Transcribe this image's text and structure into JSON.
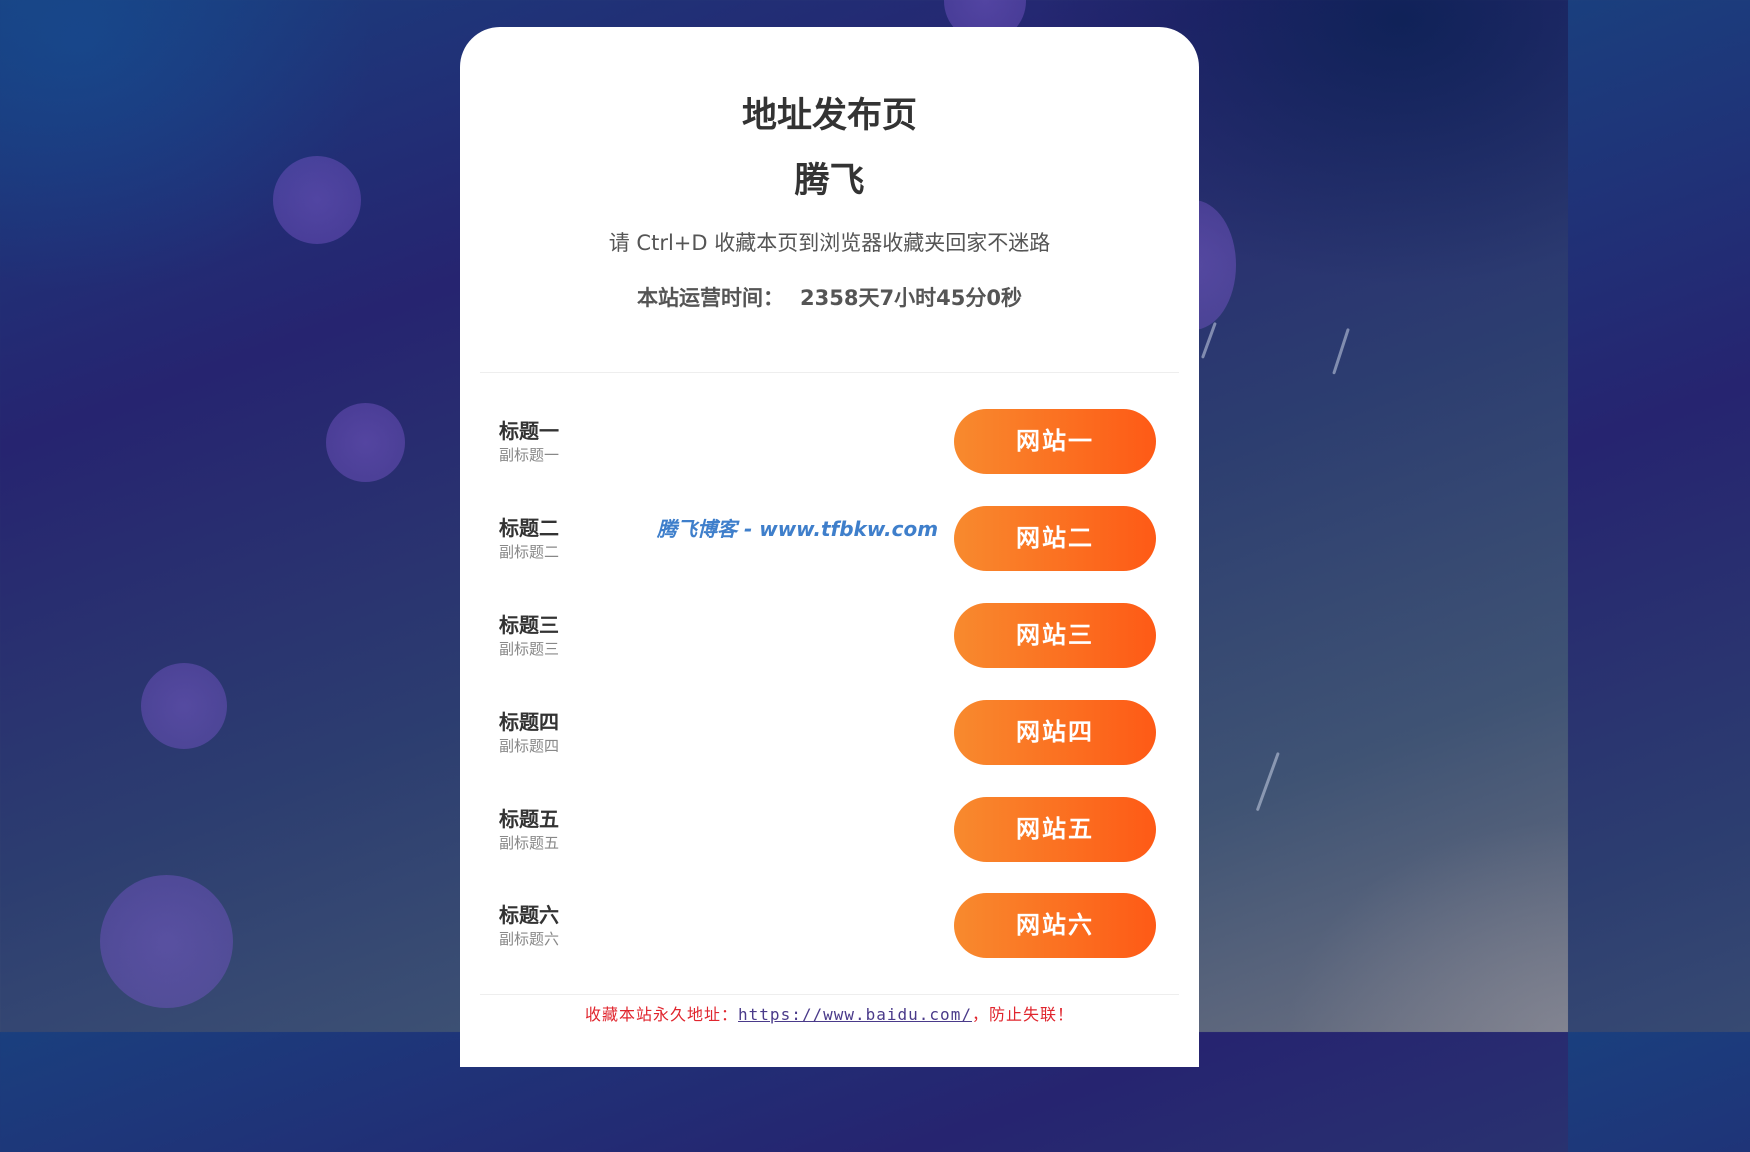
{
  "header": {
    "page_title": "地址发布页",
    "site_name": "腾飞",
    "bookmark_tip": "请 Ctrl+D 收藏本页到浏览器收藏夹回家不迷路",
    "uptime_label": "本站运营时间：",
    "uptime_value": "2358天7小时45分0秒"
  },
  "links": [
    {
      "title": "标题一",
      "subtitle": "副标题一",
      "button": "网站一"
    },
    {
      "title": "标题二",
      "subtitle": "副标题二",
      "button": "网站二"
    },
    {
      "title": "标题三",
      "subtitle": "副标题三",
      "button": "网站三"
    },
    {
      "title": "标题四",
      "subtitle": "副标题四",
      "button": "网站四"
    },
    {
      "title": "标题五",
      "subtitle": "副标题五",
      "button": "网站五"
    },
    {
      "title": "标题六",
      "subtitle": "副标题六",
      "button": "网站六"
    }
  ],
  "watermark": "腾飞博客 - www.tfbkw.com",
  "footer": {
    "prefix": "收藏本站永久地址：",
    "url": "https://www.baidu.com/",
    "suffix": "，防止失联！"
  },
  "colors": {
    "button_gradient_start": "#f88a2e",
    "button_gradient_end": "#fe5a16",
    "footer_text": "#e0262e",
    "watermark": "#3f7fcb"
  }
}
